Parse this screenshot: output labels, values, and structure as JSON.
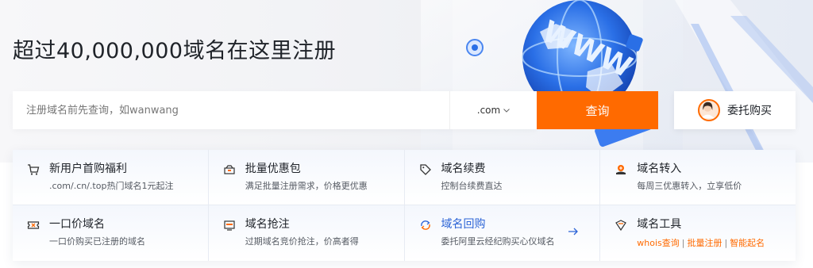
{
  "hero": {
    "title": "超过40,000,000域名在这里注册"
  },
  "search": {
    "placeholder": "注册域名前先查询，如wanwang",
    "suffix": ".com",
    "button_label": "查询"
  },
  "entrust": {
    "label": "委托购买"
  },
  "cards": [
    {
      "title": "新用户首购福利",
      "desc": ".com/.cn/.top热门域名1元起注",
      "icon": "cart-icon"
    },
    {
      "title": "批量优惠包",
      "desc": "满足批量注册需求，价格更优惠",
      "icon": "package-icon"
    },
    {
      "title": "域名续费",
      "desc": "控制台续费直达",
      "icon": "tag-icon"
    },
    {
      "title": "域名转入",
      "desc": "每周三优惠转入，立享低价",
      "icon": "transfer-icon"
    },
    {
      "title": "一口价域名",
      "desc": "一口价购买已注册的域名",
      "icon": "ticket-icon"
    },
    {
      "title": "域名抢注",
      "desc": "过期域名竞价抢注，价高者得",
      "icon": "bid-icon"
    },
    {
      "title": "域名回购",
      "desc": "委托阿里云经纪购买心仪域名",
      "icon": "buyback-icon"
    },
    {
      "title": "域名工具",
      "icon": "tool-icon",
      "links": [
        "whois查询",
        "批量注册",
        "智能起名"
      ],
      "separator": "|"
    }
  ],
  "colors": {
    "accent": "#ff6a00",
    "link_blue": "#2b63d6"
  }
}
